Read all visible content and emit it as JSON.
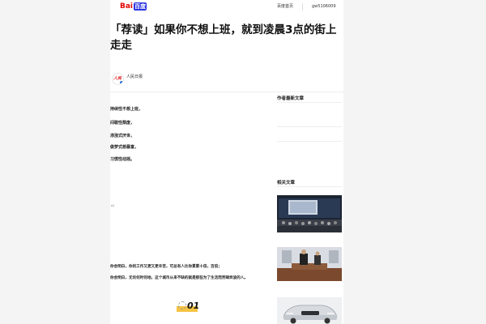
{
  "header": {
    "brand_left": "Bai",
    "brand_right": "百度",
    "home_link": "百度首页",
    "user_name": "gw5106009"
  },
  "article": {
    "title": "「荐读」如果你不想上班，就到凌晨3点的街上走走",
    "author": "人民日报",
    "meta": "",
    "intro": "",
    "points": [
      "持续性不想上班，",
      "间歇性颓废，",
      "滞涨式厌世，",
      "做梦式想暴富，",
      "习惯性动摇。"
    ],
    "para1": "",
    "para2": "",
    "quote": "",
    "para3": "",
    "para4": "",
    "bold1": "你会明白，你的工作又更又更辛苦，可总有人比你累累十倍，百倍；",
    "bold2": "你会明白，无论何时何地，这个城市从来不缺的就是那些为了生活而劳碌奔波的人。",
    "number_badge": "01"
  },
  "sidebar": {
    "author_articles_title": "作者最新文章",
    "author_articles": [
      "",
      "",
      ""
    ],
    "related_title": "相关文章",
    "related": [
      {
        "caption": ""
      },
      {
        "caption": ""
      },
      {
        "caption": ""
      }
    ]
  },
  "colors": {
    "brand_red": "#e10601",
    "brand_blue": "#2932e1",
    "badge_yellow": "#f6c342",
    "page_bg": "#f4f4f4",
    "card_bg": "#ffffff"
  },
  "icons": {
    "quote": "quote-mark-icon",
    "verified": "verified-badge-icon",
    "number": "section-number-icon"
  }
}
